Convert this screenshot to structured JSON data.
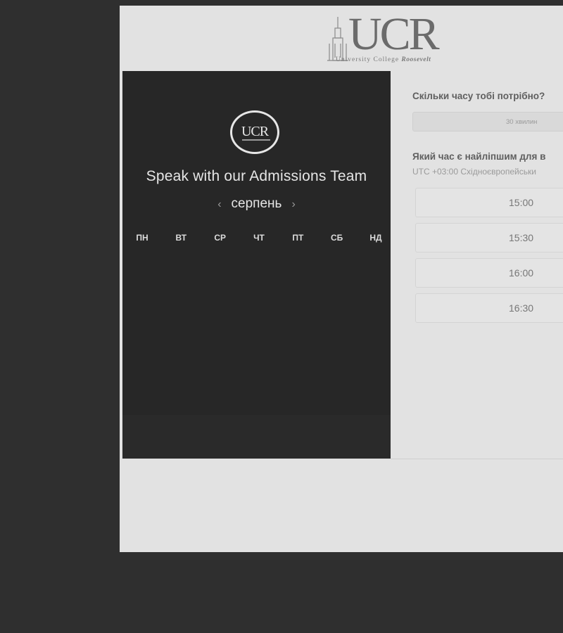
{
  "header": {
    "logo": {
      "word": "UCR",
      "subtitle": "University College",
      "subtitle_italic": "Roosevelt"
    }
  },
  "calendar": {
    "badge_word": "UCR",
    "title": "Speak with our Admissions Team",
    "month": "серпень",
    "prev_icon": "‹",
    "next_icon": "›",
    "weekdays": [
      "ПН",
      "ВТ",
      "СР",
      "ЧТ",
      "ПТ",
      "СБ",
      "НД"
    ]
  },
  "booking": {
    "duration_question": "Скільки часу тобі потрібно?",
    "duration_option": "30 хвилин",
    "time_question": "Який час є найліпшим для в",
    "timezone": "UTC +03:00 Східноєвропейськи",
    "slots": [
      "15:00",
      "15:30",
      "16:00",
      "16:30"
    ]
  }
}
